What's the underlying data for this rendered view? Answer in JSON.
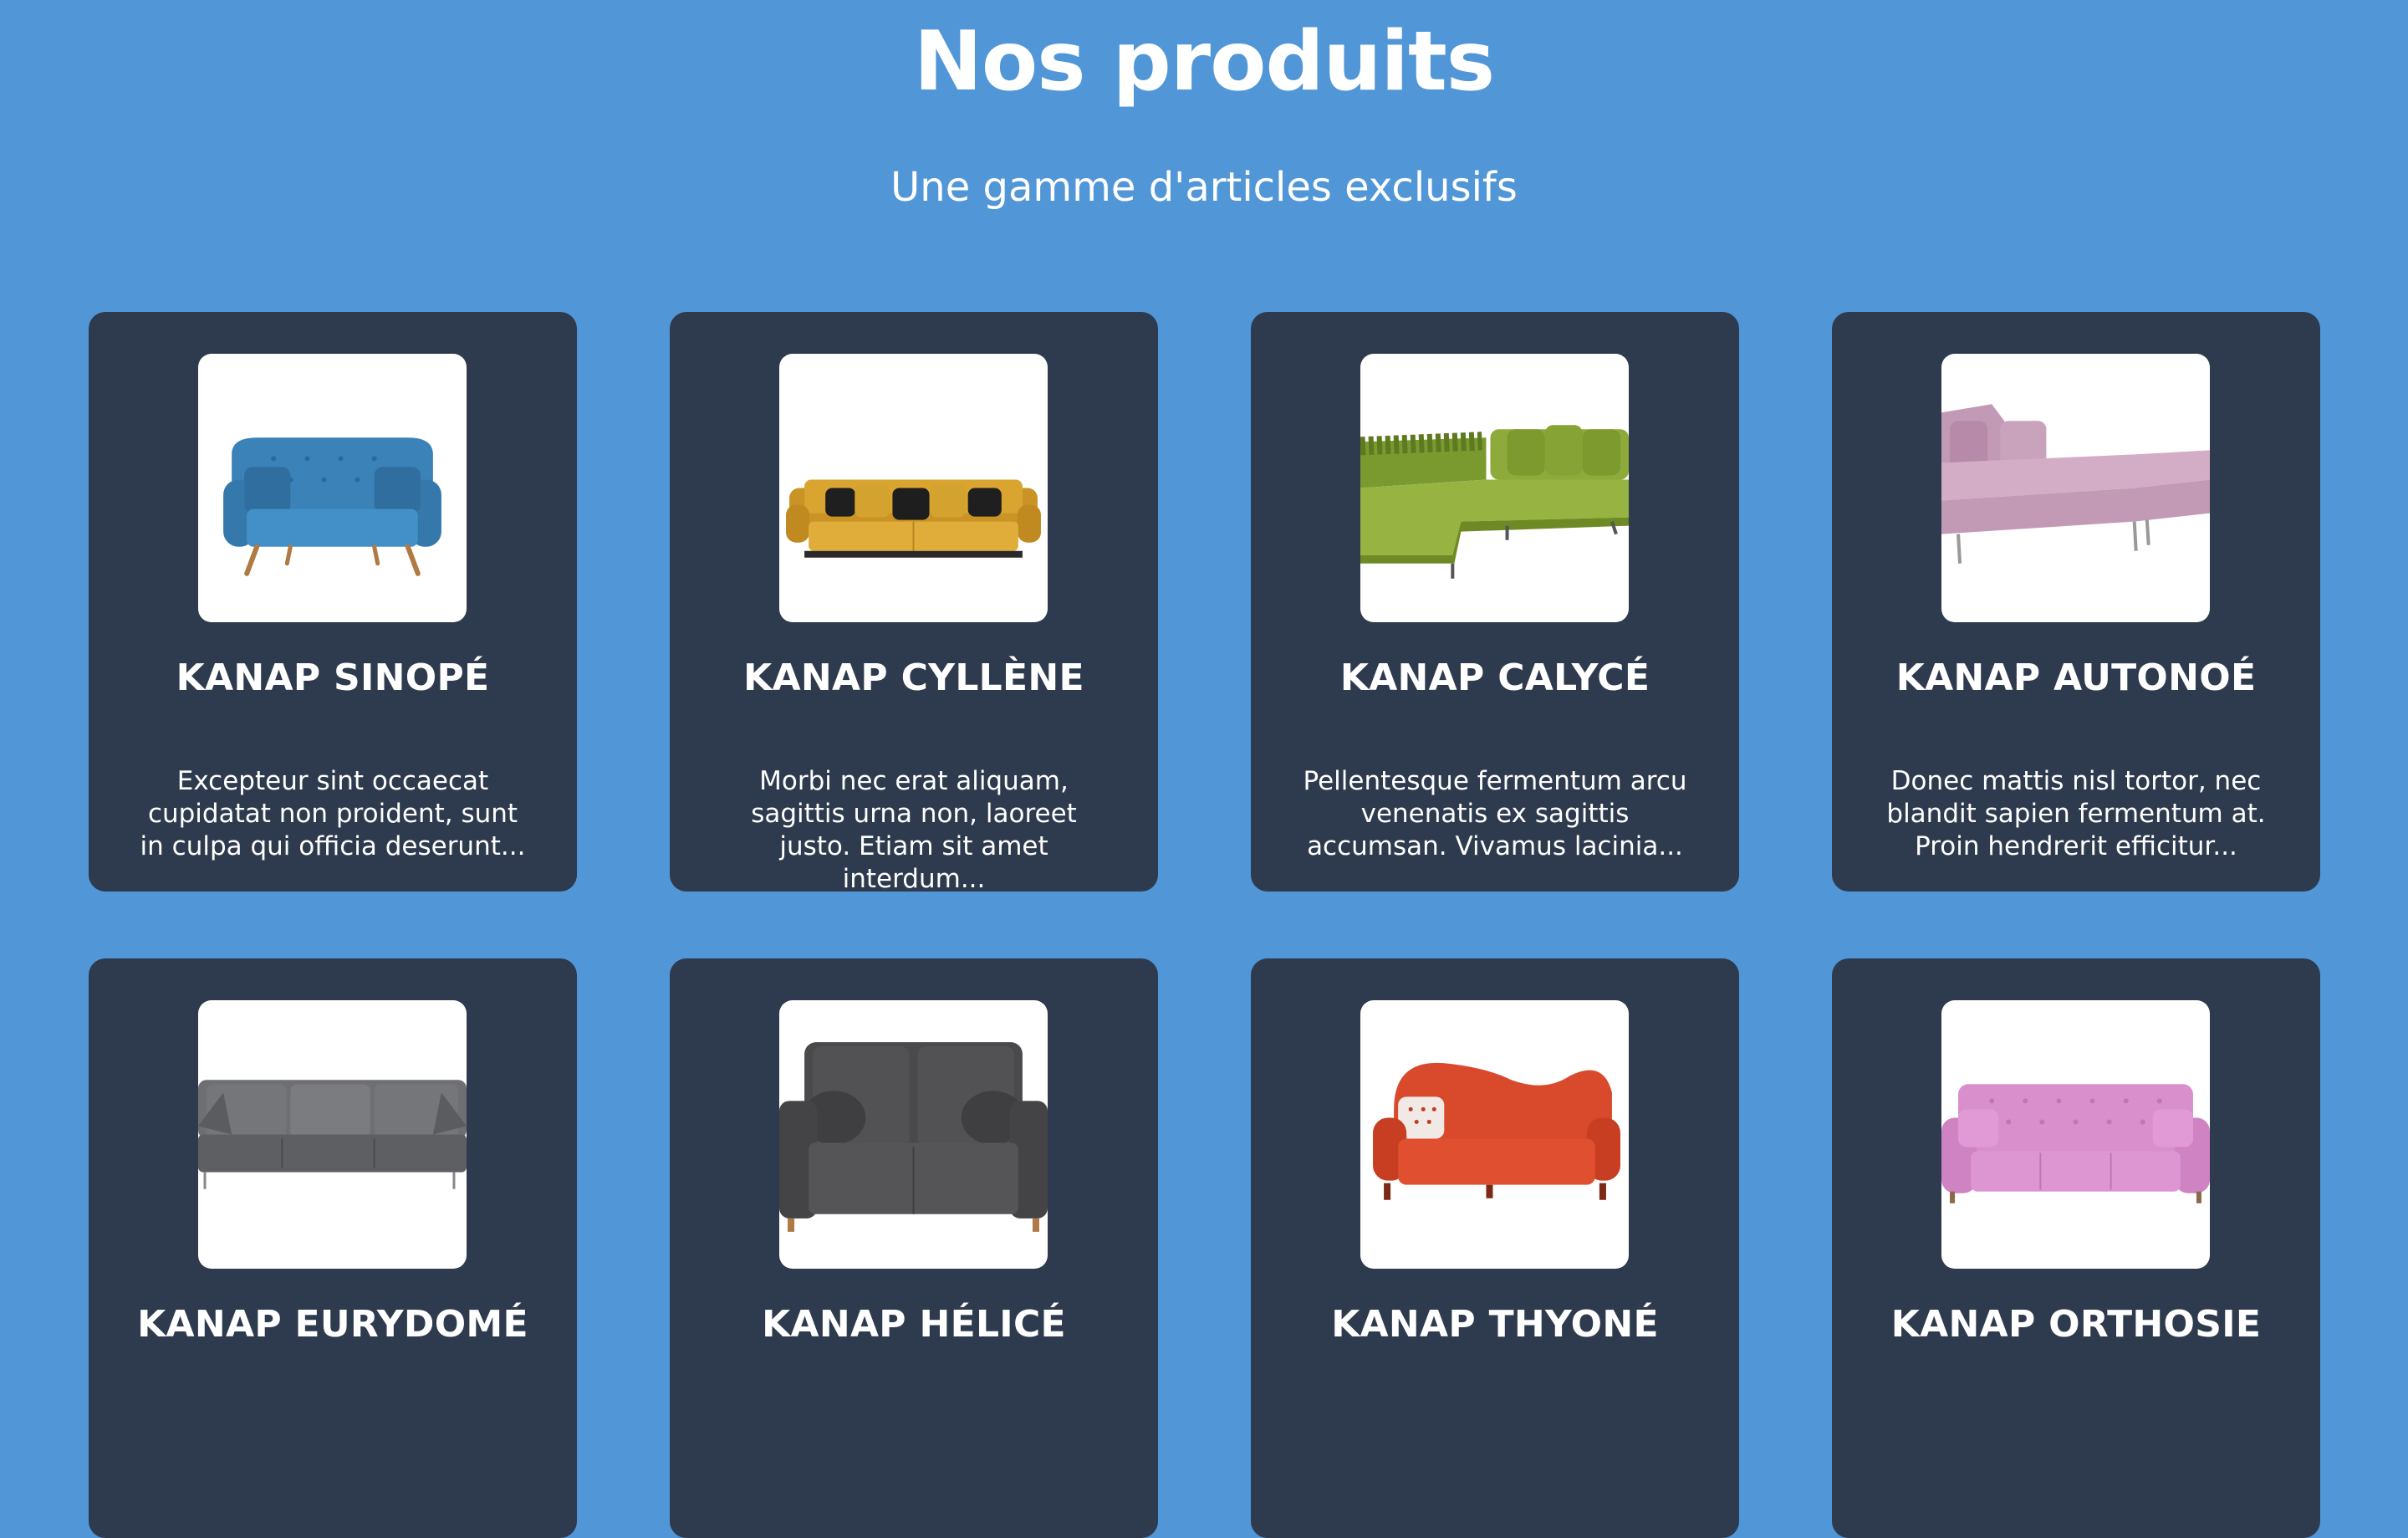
{
  "header": {
    "title": "Nos produits",
    "subtitle": "Une gamme d'articles exclusifs"
  },
  "colors": {
    "background": "#5196D6",
    "card": "#2E3A4E"
  },
  "products": [
    {
      "name": "KANAP SINOPÉ",
      "description": "Excepteur sint occaecat cupidatat non proident, sunt in culpa qui officia deserunt...",
      "image_icon": "blue-sofa-image",
      "color": "#3A82B8"
    },
    {
      "name": "KANAP CYLLÈNE",
      "description": "Morbi nec erat aliquam, sagittis urna non, laoreet justo. Etiam sit amet interdum...",
      "image_icon": "yellow-sofa-image",
      "color": "#D9A430"
    },
    {
      "name": "KANAP CALYCÉ",
      "description": "Pellentesque fermentum arcu venenatis ex sagittis accumsan. Vivamus lacinia...",
      "image_icon": "green-corner-sofa-image",
      "color": "#8DAA3A"
    },
    {
      "name": "KANAP AUTONOÉ",
      "description": "Donec mattis nisl tortor, nec blandit sapien fermentum at. Proin hendrerit efficitur...",
      "image_icon": "pink-corner-sofa-image",
      "color": "#C9A2BB"
    },
    {
      "name": "KANAP EURYDOMÉ",
      "description": "",
      "image_icon": "gray-sofa-image",
      "color": "#5E5F63"
    },
    {
      "name": "KANAP HÉLICÉ",
      "description": "",
      "image_icon": "dark-gray-sofa-image",
      "color": "#4A4A4C"
    },
    {
      "name": "KANAP THYONÉ",
      "description": "",
      "image_icon": "red-sofa-image",
      "color": "#D9492B"
    },
    {
      "name": "KANAP ORTHOSIE",
      "description": "",
      "image_icon": "pink-tufted-sofa-image",
      "color": "#D88FCB"
    }
  ]
}
